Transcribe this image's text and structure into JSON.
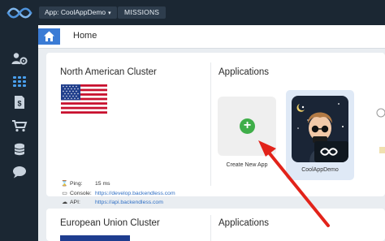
{
  "topbar": {
    "logo_icon": "backendless-logo-icon",
    "app_select_label": "App: CoolAppDemo",
    "missions_label": "MISSIONS"
  },
  "sidebar": {
    "items": [
      {
        "icon": "users-gear-icon"
      },
      {
        "icon": "grid-icon"
      },
      {
        "icon": "billing-icon"
      },
      {
        "icon": "cart-icon"
      },
      {
        "icon": "coins-icon"
      },
      {
        "icon": "chat-icon"
      }
    ]
  },
  "breadcrumb": {
    "home_icon": "home-icon",
    "title": "Home"
  },
  "cluster_na": {
    "title": "North American Cluster",
    "flag_icon": "us-flag-icon",
    "ping_label": "Ping:",
    "ping_value": "15 ms",
    "console_label": "Console:",
    "console_url": "https://develop.backendless.com",
    "api_label": "API:",
    "api_url": "https://api.backendless.com"
  },
  "applications": {
    "title": "Applications",
    "create_label": "Create New App",
    "apps": [
      {
        "name": "CoolAppDemo"
      }
    ]
  },
  "cluster_eu": {
    "title": "European Union Cluster",
    "apps_title": "Applications"
  },
  "colors": {
    "topbar_bg": "#1b2733",
    "accent_blue": "#3a7bd5",
    "plus_green": "#3fae49",
    "link_blue": "#2f6fc4",
    "arrow_red": "#e2231a"
  }
}
